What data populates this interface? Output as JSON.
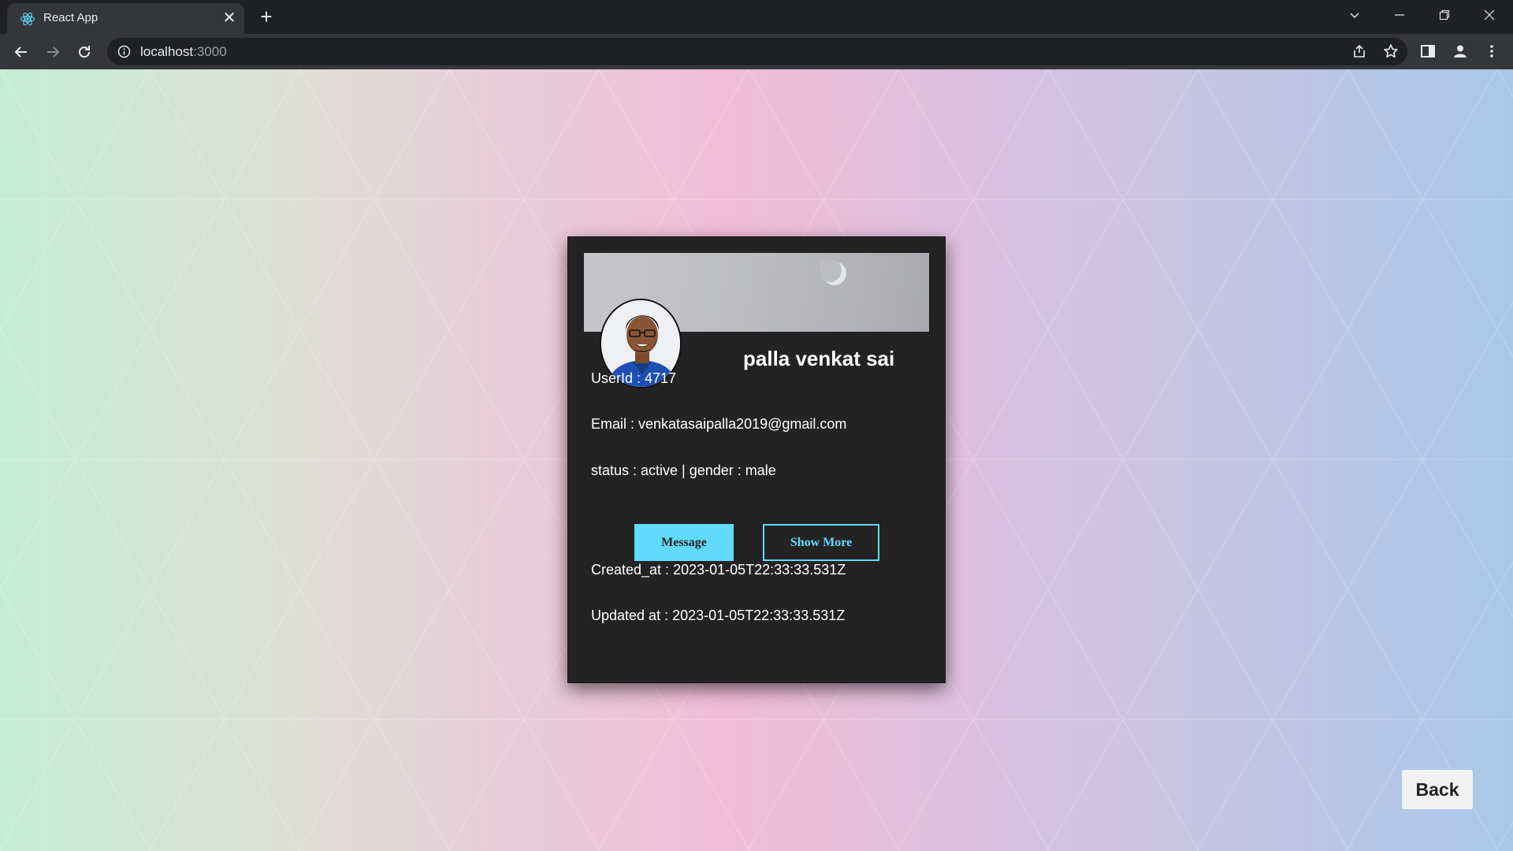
{
  "browser": {
    "tab_title": "React App",
    "url_host": "localhost",
    "url_port": ":3000"
  },
  "profile": {
    "name": "palla venkat sai",
    "user_id_line": "UserId : 4717",
    "email_line": "Email : venkatasaipalla2019@gmail.com",
    "status_line": "status : active | gender : male",
    "created_line": "Created_at : 2023-01-05T22:33:33.531Z",
    "updated_line": "Updated at : 2023-01-05T22:33:33.531Z"
  },
  "buttons": {
    "message": "Message",
    "show_more": "Show More",
    "back": "Back"
  },
  "colors": {
    "accent": "#61dafb",
    "card_bg": "#232323"
  },
  "icons": [
    "react-logo-icon",
    "close-icon",
    "plus-icon",
    "back-arrow-icon",
    "forward-arrow-icon",
    "reload-icon",
    "info-icon",
    "share-icon",
    "star-icon",
    "side-panel-icon",
    "profile-icon",
    "kebab-menu-icon",
    "chevron-down-icon",
    "minimize-icon",
    "restore-icon",
    "window-close-icon"
  ]
}
